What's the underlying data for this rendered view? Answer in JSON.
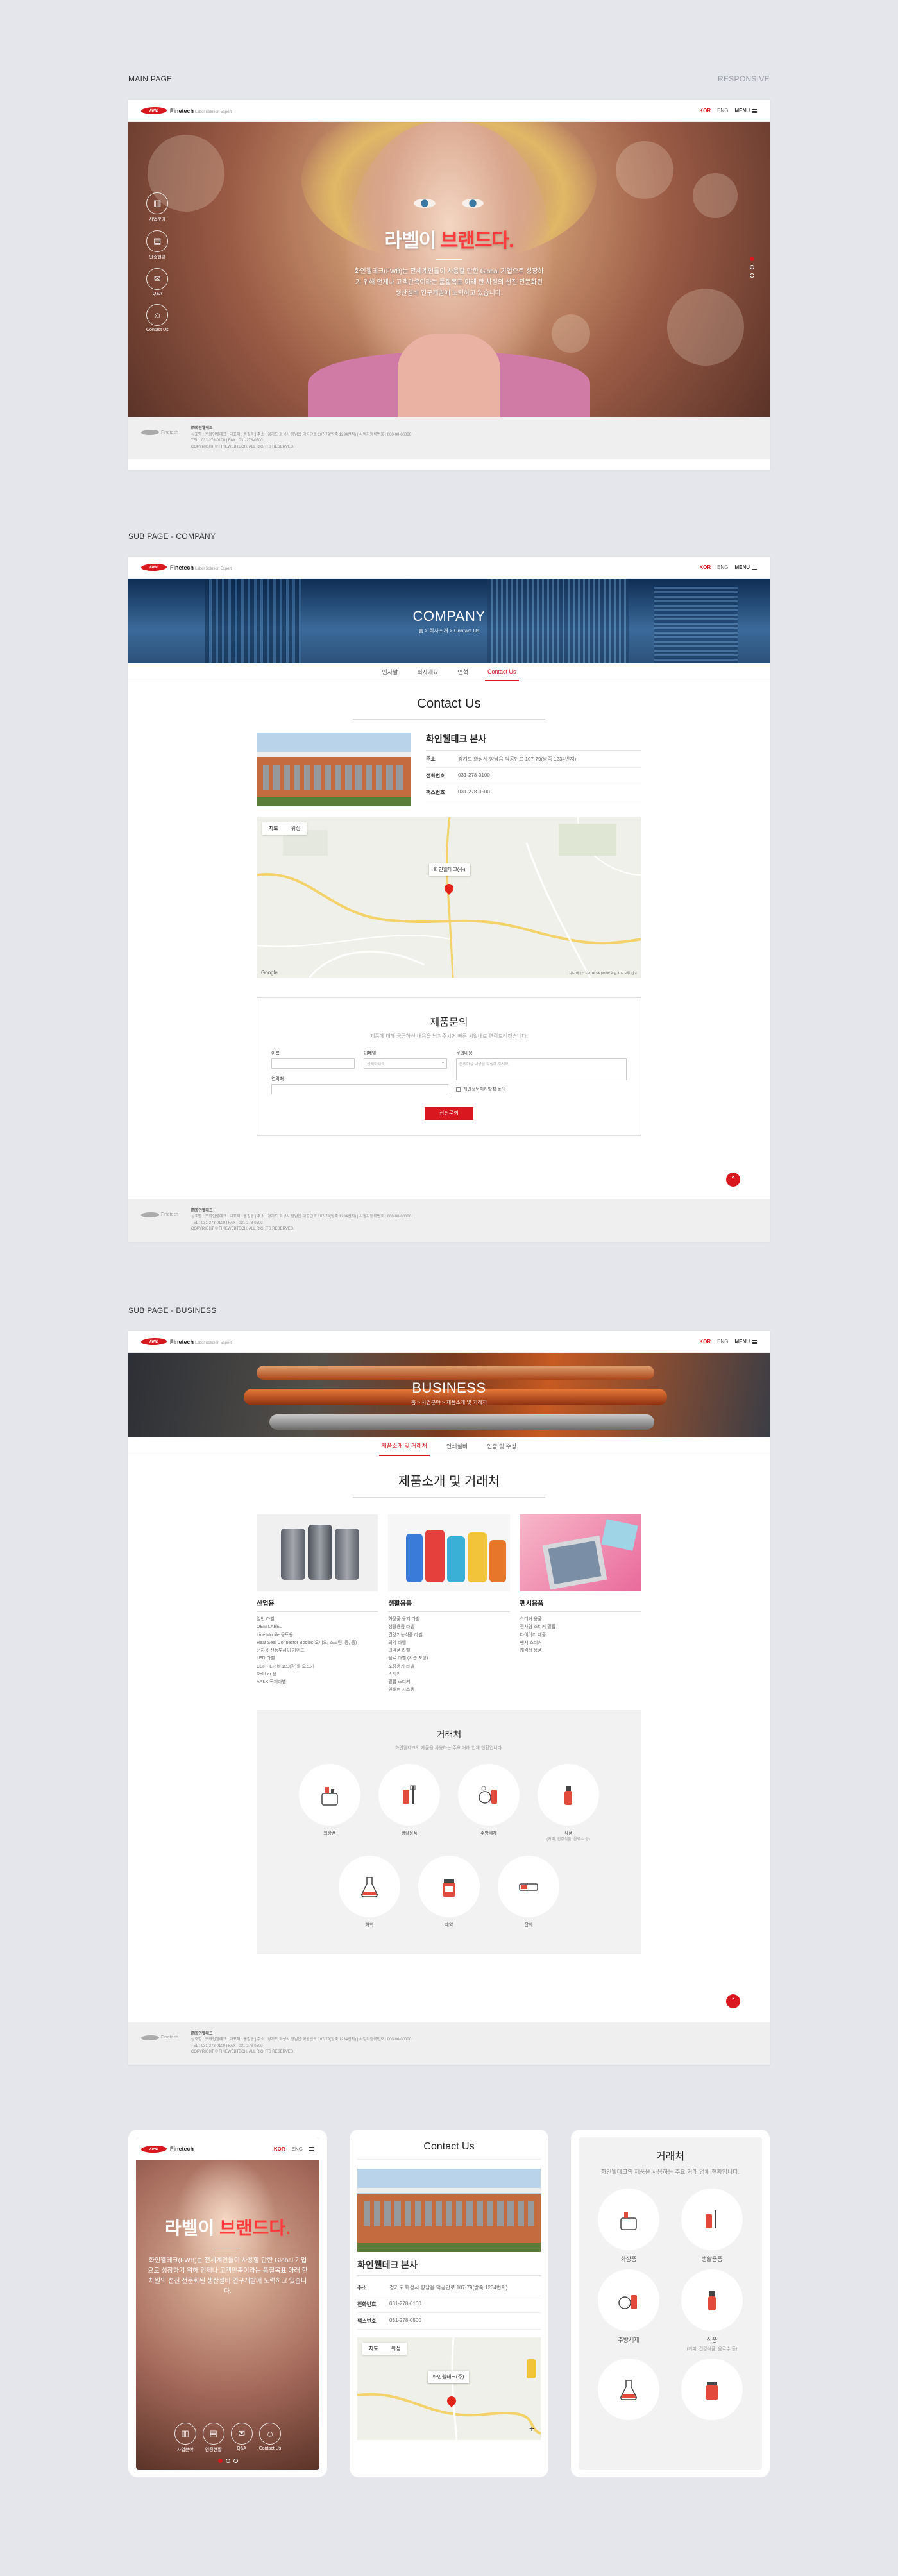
{
  "labels": {
    "main": "MAIN PAGE",
    "responsive": "RESPONSIVE",
    "company": "SUB PAGE - COMPANY",
    "business": "SUB PAGE - BUSINESS"
  },
  "header": {
    "logo_badge": "FINE",
    "logo_name": "Finetech",
    "logo_tagline": "Label Solution Expert",
    "kor": "KOR",
    "eng": "ENG",
    "menu": "MENU"
  },
  "hero": {
    "title_a": "라벨이 ",
    "title_b": "브랜드다.",
    "desc": "화인웰테크(FWB)는 전세계인들이 사용할 만한 Global 기업으로 성장하기 위해 언제나 고객만족이라는 품질목표 아래 한 차원의 선진 전문화된 생산설비 연구개발에 노력하고 있습니다.",
    "side": [
      {
        "label": "사업분야",
        "icon": "building-icon"
      },
      {
        "label": "인증현황",
        "icon": "certificate-icon"
      },
      {
        "label": "Q&A",
        "icon": "chat-icon"
      },
      {
        "label": "Contact Us",
        "icon": "people-icon"
      }
    ]
  },
  "footer": {
    "logo": "Finetech",
    "company": "㈜화인웰테크",
    "line1": "상호명 : ㈜화인웰테크  |  대표자 : 홍길동  |  주소 : 경기도 화성시 향남읍 덕공단로 107-79(방죽 1234번지)  |  사업자등록번호 : 000-00-00000",
    "line2": "TEL : 031-278-0100  |  FAX : 031-278-0500",
    "copy": "COPYRIGHT © FINEWEBTECH. ALL RIGHTS RESERVED."
  },
  "company": {
    "banner_title": "COMPANY",
    "crumb": "홈 > 회사소개 > Contact Us",
    "tabs": [
      "인사말",
      "회사개요",
      "연혁",
      "Contact Us"
    ],
    "heading": "Contact Us",
    "hq_name": "화인웰테크 본사",
    "rows": [
      {
        "k": "주소",
        "v": "경기도 화성시 향남읍 덕공단로 107-79(방죽 1234번지)"
      },
      {
        "k": "전화번호",
        "v": "031-278-0100"
      },
      {
        "k": "팩스번호",
        "v": "031-278-0500"
      }
    ],
    "map_tabs": [
      "지도",
      "위성"
    ],
    "map_bubble": "화인웰테크(주)",
    "map_note": "지도 데이터 ©2016 SK planet  약관  지도 오류 신고",
    "map_google": "Google"
  },
  "form": {
    "title": "제품문의",
    "sub": "제품에 대해 궁금하신 내용을 남겨주시면 빠른 시일내로 연락드리겠습니다.",
    "name_label": "이름",
    "email_label": "이메일",
    "email_select": "선택하세요",
    "inquiry_label": "문의내용",
    "inquiry_ph": "문의하실 내용을 작성해 주세요.",
    "phone_label": "연락처",
    "agree": "개인정보처리방침 동의",
    "submit": "상담문의"
  },
  "business": {
    "banner_title": "BUSINESS",
    "crumb": "홈 > 사업분야 > 제품소개 및 거래처",
    "tabs": [
      "제품소개 및 거래처",
      "인쇄설비",
      "인증 및 수상"
    ],
    "heading": "제품소개 및 거래처",
    "cats": [
      {
        "title": "산업용",
        "items": [
          "일반 라벨",
          "OEM LABEL",
          "Line Mobile 용도용",
          "Heat Seal Connector Bodies(오디오, 스크린, 등, 등)",
          "전자용 전동부사이 가이드",
          "LED 라벨",
          "CLIPPER 바코드(강)를 오프기",
          "RoLLer 용",
          "ARLK 국제라벨"
        ]
      },
      {
        "title": "생활용품",
        "items": [
          "화장품 용기 라벨",
          "생활용품 라벨",
          "건강기능식품 라벨",
          "의약 라벨",
          "의약품 라벨",
          "음료 라벨 (시즌 포장)",
          "포장용기 라벨",
          "스티커",
          "필름 스티커",
          "인쇄형 시스템"
        ]
      },
      {
        "title": "팬시용품",
        "items": [
          "스티커 용품",
          "전사형 스티커 필름",
          "다이어리 제품",
          "팬시 스티커",
          "캐릭터 용품"
        ]
      }
    ],
    "clients_title": "거래처",
    "clients_sub": "화인웰테크의 제품을 사용하는 주요 거래 업체 현황입니다.",
    "clients": [
      {
        "label": "화장품",
        "icon": "cosmetics-icon"
      },
      {
        "label": "생활용품",
        "icon": "toothbrush-icon"
      },
      {
        "label": "주방세제",
        "icon": "dish-soap-icon"
      },
      {
        "label": "식품",
        "sub": "(커피, 건강식품, 음료수 등)",
        "icon": "spray-bottle-icon"
      },
      {
        "label": "화학",
        "icon": "flask-icon"
      },
      {
        "label": "제약",
        "icon": "pill-bottle-icon"
      },
      {
        "label": "잡화",
        "icon": "toolbox-icon"
      }
    ]
  },
  "mobile": {
    "m1": {
      "title_a": "라벨이 ",
      "title_b": "브랜드다.",
      "desc": "화인웰테크(FWB)는 전세계인들이 사용할 만한 Global 기업으로 성장하기 위해 언제나 고객만족이라는 품질목표 아래 한 차원의 선진 전문화된 생산설비 연구개발에 노력하고 있습니다."
    },
    "m2": {
      "heading": "Contact Us",
      "hq_name": "화인웰테크 본사",
      "addr": "경기도 화성시 향남읍 덕공단로 107-79(방죽 1234번지)"
    },
    "m3": {
      "title": "거래처",
      "sub": "화인웰테크의 제품을 사용하는 주요 거래 업체 현황입니다."
    }
  }
}
